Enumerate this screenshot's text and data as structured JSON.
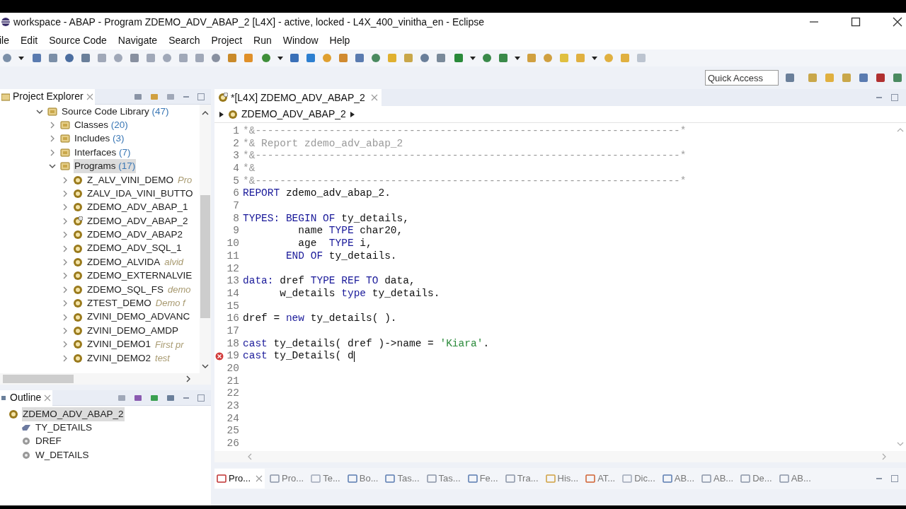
{
  "window": {
    "title": "workspace - ABAP - Program ZDEMO_ADV_ABAP_2 [L4X] - active, locked - L4X_400_vinitha_en - Eclipse"
  },
  "menu": [
    "ile",
    "Edit",
    "Source Code",
    "Navigate",
    "Search",
    "Project",
    "Run",
    "Window",
    "Help"
  ],
  "quick_access": {
    "placeholder": "Quick Access"
  },
  "project_explorer": {
    "title": "Project Explorer",
    "tree": [
      {
        "label": "Source Code Library",
        "count": "(47)",
        "kind": "library",
        "expanded": true,
        "selected": false,
        "children": [
          {
            "label": "Classes",
            "count": "(20)",
            "kind": "folder",
            "expanded": false,
            "selected": false
          },
          {
            "label": "Includes",
            "count": "(3)",
            "kind": "folder",
            "expanded": false,
            "selected": false
          },
          {
            "label": "Interfaces",
            "count": "(7)",
            "kind": "folder",
            "expanded": false,
            "selected": false
          },
          {
            "label": "Programs",
            "count": "(17)",
            "kind": "folder",
            "expanded": true,
            "selected": true,
            "children": [
              {
                "label": "Z_ALV_VINI_DEMO",
                "description": "Pro",
                "kind": "program",
                "expanded": false,
                "selected": false
              },
              {
                "label": "ZALV_IDA_VINI_BUTTO",
                "kind": "program",
                "expanded": false,
                "selected": false
              },
              {
                "label": "ZDEMO_ADV_ABAP_1",
                "kind": "program",
                "expanded": false,
                "selected": false
              },
              {
                "label": "ZDEMO_ADV_ABAP_2",
                "kind": "modified",
                "expanded": false,
                "selected": false
              },
              {
                "label": "ZDEMO_ADV_ABAP2",
                "kind": "program",
                "expanded": false,
                "selected": false
              },
              {
                "label": "ZDEMO_ADV_SQL_1",
                "kind": "program",
                "expanded": false,
                "selected": false
              },
              {
                "label": "ZDEMO_ALVIDA",
                "description": "alvid",
                "kind": "program",
                "expanded": false,
                "selected": false
              },
              {
                "label": "ZDEMO_EXTERNALVIE",
                "kind": "program",
                "expanded": false,
                "selected": false
              },
              {
                "label": "ZDEMO_SQL_FS",
                "description": "demo",
                "kind": "program",
                "expanded": false,
                "selected": false
              },
              {
                "label": "ZTEST_DEMO",
                "description": "Demo f",
                "kind": "program",
                "expanded": false,
                "selected": false
              },
              {
                "label": "ZVINI_DEMO_ADVANC",
                "kind": "program",
                "expanded": false,
                "selected": false
              },
              {
                "label": "ZVINI_DEMO_AMDP",
                "kind": "program",
                "expanded": false,
                "selected": false
              },
              {
                "label": "ZVINI_DEMO1",
                "description": "First pr",
                "kind": "program",
                "expanded": false,
                "selected": false
              },
              {
                "label": "ZVINI_DEMO2",
                "description": "test",
                "kind": "program",
                "expanded": false,
                "selected": false
              }
            ]
          }
        ]
      }
    ]
  },
  "outline": {
    "title": "Outline",
    "tree": [
      {
        "label": "ZDEMO_ADV_ABAP_2",
        "kind": "program",
        "selected": true,
        "children": [
          {
            "label": "TY_DETAILS",
            "kind": "type",
            "selected": false
          },
          {
            "label": "DREF",
            "kind": "data",
            "selected": false
          },
          {
            "label": "W_DETAILS",
            "kind": "data",
            "selected": false
          }
        ]
      }
    ]
  },
  "editor": {
    "tab": {
      "label": "*[L4X] ZDEMO_ADV_ABAP_2",
      "selected": true
    },
    "breadcrumb": "ZDEMO_ADV_ABAP_2",
    "lines": [
      {
        "number": "1",
        "error": false,
        "cursor": false,
        "tokens": [
          {
            "kind": "comment",
            "text": "*&---------------------------------------------------------------------*"
          }
        ]
      },
      {
        "number": "2",
        "error": false,
        "cursor": false,
        "tokens": [
          {
            "kind": "comment",
            "text": "*& Report zdemo_adv_abap_2"
          }
        ]
      },
      {
        "number": "3",
        "error": false,
        "cursor": false,
        "tokens": [
          {
            "kind": "comment",
            "text": "*&---------------------------------------------------------------------*"
          }
        ]
      },
      {
        "number": "4",
        "error": false,
        "cursor": false,
        "tokens": [
          {
            "kind": "comment",
            "text": "*&"
          }
        ]
      },
      {
        "number": "5",
        "error": false,
        "cursor": false,
        "tokens": [
          {
            "kind": "comment",
            "text": "*&---------------------------------------------------------------------*"
          }
        ]
      },
      {
        "number": "6",
        "error": false,
        "cursor": false,
        "tokens": [
          {
            "kind": "keyword",
            "text": "REPORT"
          },
          {
            "kind": "plain",
            "text": " zdemo_adv_abap_2."
          }
        ]
      },
      {
        "number": "7",
        "error": false,
        "cursor": false
      },
      {
        "number": "8",
        "error": false,
        "cursor": false,
        "tokens": [
          {
            "kind": "keyword",
            "text": "TYPES: BEGIN OF"
          },
          {
            "kind": "plain",
            "text": " ty_details,"
          }
        ]
      },
      {
        "number": "9",
        "error": false,
        "cursor": false,
        "tokens": [
          {
            "kind": "plain",
            "text": "         name "
          },
          {
            "kind": "keyword",
            "text": "TYPE"
          },
          {
            "kind": "plain",
            "text": " char20,"
          }
        ]
      },
      {
        "number": "10",
        "error": false,
        "cursor": false,
        "tokens": [
          {
            "kind": "plain",
            "text": "         age  "
          },
          {
            "kind": "keyword",
            "text": "TYPE"
          },
          {
            "kind": "plain",
            "text": " i,"
          }
        ]
      },
      {
        "number": "11",
        "error": false,
        "cursor": false,
        "tokens": [
          {
            "kind": "keyword",
            "text": "       END OF"
          },
          {
            "kind": "plain",
            "text": " ty_details."
          }
        ]
      },
      {
        "number": "12",
        "error": false,
        "cursor": false
      },
      {
        "number": "13",
        "error": false,
        "cursor": false,
        "tokens": [
          {
            "kind": "keyword",
            "text": "data:"
          },
          {
            "kind": "plain",
            "text": " dref "
          },
          {
            "kind": "keyword",
            "text": "TYPE REF TO"
          },
          {
            "kind": "plain",
            "text": " data,"
          }
        ]
      },
      {
        "number": "14",
        "error": false,
        "cursor": false,
        "tokens": [
          {
            "kind": "plain",
            "text": "      w_details "
          },
          {
            "kind": "keyword",
            "text": "type"
          },
          {
            "kind": "plain",
            "text": " ty_details."
          }
        ]
      },
      {
        "number": "15",
        "error": false,
        "cursor": false
      },
      {
        "number": "16",
        "error": false,
        "cursor": false,
        "tokens": [
          {
            "kind": "plain",
            "text": "dref = "
          },
          {
            "kind": "keyword",
            "text": "new"
          },
          {
            "kind": "plain",
            "text": " ty_details( )."
          }
        ]
      },
      {
        "number": "17",
        "error": false,
        "cursor": false
      },
      {
        "number": "18",
        "error": false,
        "cursor": false,
        "tokens": [
          {
            "kind": "keyword",
            "text": "cast"
          },
          {
            "kind": "plain",
            "text": " ty_details( dref )->name = "
          },
          {
            "kind": "string",
            "text": "'Kiara'"
          },
          {
            "kind": "plain",
            "text": "."
          }
        ]
      },
      {
        "number": "19",
        "error": true,
        "cursor": true,
        "tokens": [
          {
            "kind": "keyword",
            "text": "cast"
          },
          {
            "kind": "plain",
            "text": " ty_Details( d"
          }
        ]
      },
      {
        "number": "20",
        "error": false,
        "cursor": false
      },
      {
        "number": "21",
        "error": false,
        "cursor": false
      },
      {
        "number": "22",
        "error": false,
        "cursor": false
      },
      {
        "number": "23",
        "error": false,
        "cursor": false
      },
      {
        "number": "24",
        "error": false,
        "cursor": false
      },
      {
        "number": "25",
        "error": false,
        "cursor": false
      },
      {
        "number": "26",
        "error": false,
        "cursor": false
      }
    ]
  },
  "bottom_tabs": [
    {
      "label": "Pro...",
      "selected": true
    },
    {
      "label": "Pro...",
      "selected": false
    },
    {
      "label": "Te...",
      "selected": false
    },
    {
      "label": "Bo...",
      "selected": false
    },
    {
      "label": "Tas...",
      "selected": false
    },
    {
      "label": "Tas...",
      "selected": false
    },
    {
      "label": "Fe...",
      "selected": false
    },
    {
      "label": "Tra...",
      "selected": false
    },
    {
      "label": "His...",
      "selected": false
    },
    {
      "label": "AT...",
      "selected": false
    },
    {
      "label": "Dic...",
      "selected": false
    },
    {
      "label": "AB...",
      "selected": false
    },
    {
      "label": "AB...",
      "selected": false
    },
    {
      "label": "De...",
      "selected": false
    },
    {
      "label": "AB...",
      "selected": false
    }
  ]
}
